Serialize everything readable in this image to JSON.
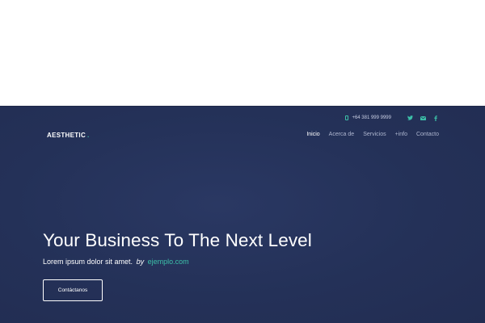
{
  "topbar": {
    "phone": "+64 381 999 9999",
    "social_icons": [
      "twitter-icon",
      "mail-icon",
      "facebook-icon"
    ],
    "accent_color": "#3cc0a8"
  },
  "header": {
    "brand": "AESTHETIC",
    "brand_dot": ".",
    "nav": [
      {
        "label": "Inicio",
        "active": true
      },
      {
        "label": "Acerca de"
      },
      {
        "label": "Servicios"
      },
      {
        "label": "+info"
      },
      {
        "label": "Contacto"
      }
    ]
  },
  "hero": {
    "headline": "Your Business To The Next Level",
    "subline": "Lorem ipsum dolor sit amet.",
    "by": "by",
    "link": "ejemplo.com",
    "cta": "Contáctanos",
    "background_color": "#243158"
  }
}
